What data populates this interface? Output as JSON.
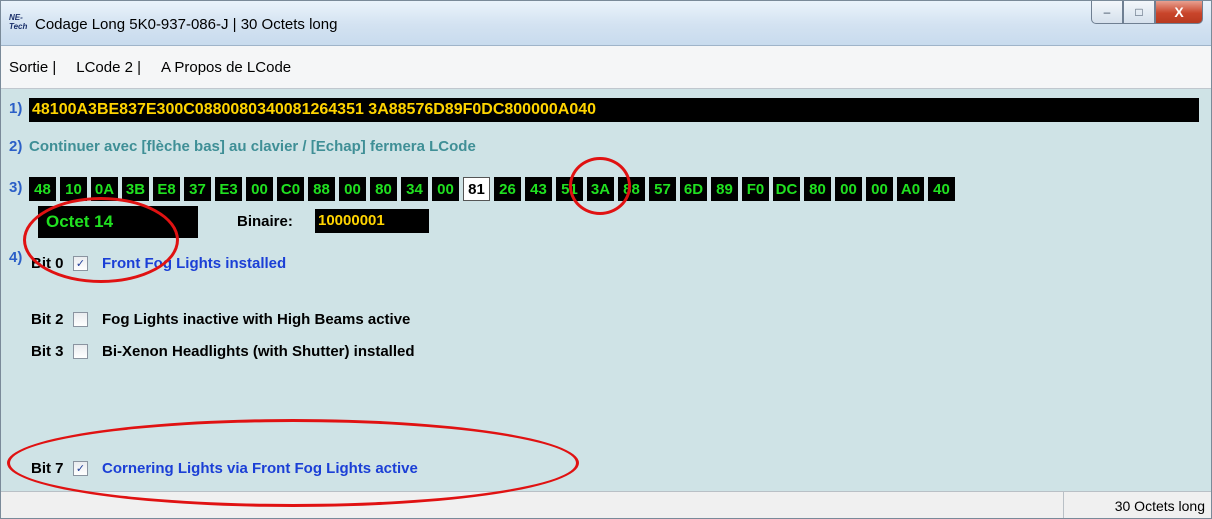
{
  "window": {
    "app_icon_text": "NE-Tech",
    "title": "Codage Long  5K0-937-086-J | 30 Octets long",
    "minimize_label": "–",
    "maximize_label": "□",
    "close_label": "X"
  },
  "menu": {
    "items": [
      "Sortie |",
      "LCode 2 |",
      "A Propos de LCode"
    ]
  },
  "steps": {
    "s1": "1)",
    "s2": "2)",
    "s3": "3)",
    "s4": "4)"
  },
  "hex_code": "48100A3BE837E300C0880080340081264351 3A88576D89F0DC800000A040",
  "instruction": "Continuer avec [flèche bas] au clavier / [Echap] fermera LCode",
  "bytes": [
    "48",
    "10",
    "0A",
    "3B",
    "E8",
    "37",
    "E3",
    "00",
    "C0",
    "88",
    "00",
    "80",
    "34",
    "00",
    "81",
    "26",
    "43",
    "51",
    "3A",
    "88",
    "57",
    "6D",
    "89",
    "F0",
    "DC",
    "80",
    "00",
    "00",
    "A0",
    "40"
  ],
  "selected_byte_index": 14,
  "octet_label": "Octet 14",
  "binary": {
    "label": "Binaire:",
    "value": "10000001"
  },
  "bits": [
    {
      "label": "Bit 0",
      "checked": true,
      "desc": "Front Fog Lights installed",
      "highlight": true
    },
    {
      "label": "Bit 2",
      "checked": false,
      "desc": "Fog Lights inactive with High Beams active",
      "highlight": false
    },
    {
      "label": "Bit 3",
      "checked": false,
      "desc": "Bi-Xenon Headlights (with Shutter) installed",
      "highlight": false
    },
    {
      "label": "Bit 7",
      "checked": true,
      "desc": "Cornering Lights via Front Fog Lights active",
      "highlight": true
    }
  ],
  "status": {
    "text": "30 Octets long"
  },
  "colors": {
    "background": "#cfe3e6",
    "hex_text": "#ffd400",
    "byte_text": "#20e020",
    "accent_red": "#e01212",
    "link_blue": "#1b3fd6"
  }
}
